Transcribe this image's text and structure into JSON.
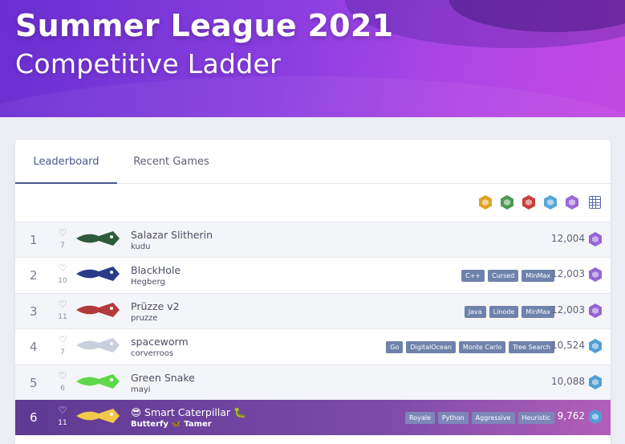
{
  "header": {
    "title": "Summer League 2021",
    "subtitle": "Competitive Ladder"
  },
  "tabs": [
    {
      "label": "Leaderboard",
      "active": true
    },
    {
      "label": "Recent Games",
      "active": false
    }
  ],
  "filters": {
    "tier_icons": [
      "gold-tier-icon",
      "green-tier-icon",
      "red-tier-icon",
      "blue-tier-icon",
      "purple-tier-icon"
    ],
    "view_icon": "grid-icon"
  },
  "colors": {
    "accent": "#4b5a8c",
    "hero_start": "#6a2fd0",
    "hero_end": "#c448e2",
    "tag": "#6e82ab",
    "highlight_row": "#5e3a92"
  },
  "rows": [
    {
      "rank": "1",
      "likes": "7",
      "name": "Salazar Slitherin",
      "author": "kudu",
      "tags": [],
      "score": "12,004",
      "tier": "purple",
      "snake_color": "#2e5b3a"
    },
    {
      "rank": "2",
      "likes": "10",
      "name": "BlackHole",
      "author": "Hegberg",
      "tags": [
        "C++",
        "Cursed",
        "MinMax"
      ],
      "score": "12,003",
      "tier": "purple",
      "snake_color": "#2b3b8a"
    },
    {
      "rank": "3",
      "likes": "11",
      "name": "Prüzze v2",
      "author": "pruzze",
      "tags": [
        "Java",
        "Linode",
        "MinMax"
      ],
      "score": "12,003",
      "tier": "purple",
      "snake_color": "#b23a3a"
    },
    {
      "rank": "4",
      "likes": "7",
      "name": "spaceworm",
      "author": "corverroos",
      "tags": [
        "Go",
        "DigitalOcean",
        "Monte Carlo",
        "Tree Search"
      ],
      "score": "10,524",
      "tier": "blue",
      "snake_color": "#c9cfdc"
    },
    {
      "rank": "5",
      "likes": "6",
      "name": "Green Snake",
      "author": "mayi",
      "tags": [],
      "score": "10,088",
      "tier": "blue",
      "snake_color": "#5ed84a"
    },
    {
      "rank": "6",
      "likes": "11",
      "name": "😎 Smart Caterpillar 🐛",
      "author": "Butterfy 🦋 Tamer",
      "tags": [
        "Royale",
        "Python",
        "Aggressive",
        "Heuristic"
      ],
      "score": "9,762",
      "tier": "blue",
      "snake_color": "#f2c84b"
    }
  ]
}
